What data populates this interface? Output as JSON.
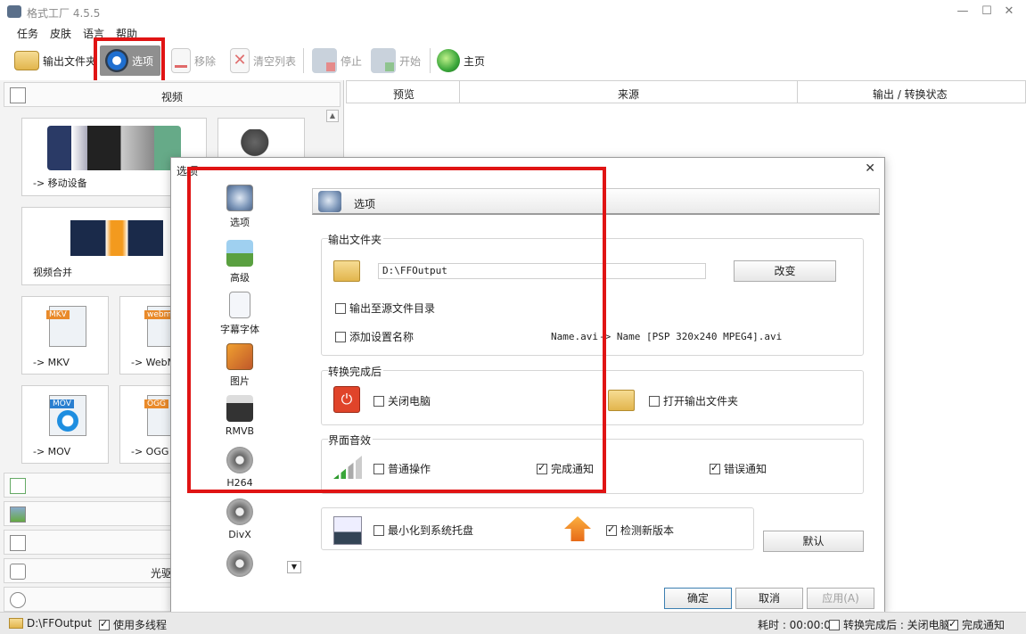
{
  "window": {
    "title": "格式工厂 4.5.5"
  },
  "menu": [
    "任务",
    "皮肤",
    "语言",
    "帮助"
  ],
  "toolbar": {
    "output_folder": "输出文件夹",
    "options": "选项",
    "remove": "移除",
    "clear_list": "清空列表",
    "stop": "停止",
    "start": "开始",
    "home": "主页"
  },
  "left": {
    "video_header": "视频",
    "tiles": {
      "mobile": "-> 移动设备",
      "merge": "视频合并",
      "mkv": "-> MKV",
      "webm": "-> WebM",
      "mov": "-> MOV",
      "ogg": "-> OGG"
    },
    "tile_badges": {
      "mkv": "MKV",
      "webm": "webm",
      "mov": "MOV",
      "ogg": "OGG"
    },
    "optical_header": "光驱设备"
  },
  "list_header": {
    "preview": "预览",
    "source": "来源",
    "status": "输出 / 转换状态"
  },
  "status": {
    "output_path": "D:\\FFOutput",
    "multithread": "使用多线程",
    "elapsed": "耗时 : 00:00:00",
    "after_convert": "转换完成后 : 关闭电脑",
    "notify": "完成通知"
  },
  "dialog": {
    "title": "选项",
    "nav": [
      "选项",
      "高级",
      "字幕字体",
      "图片",
      "RMVB",
      "H264",
      "DivX"
    ],
    "section_title": "选项",
    "output_folder_group": "输出文件夹",
    "output_path": "D:\\FFOutput",
    "change": "改变",
    "to_source_dir": "输出至源文件目录",
    "add_setting_name": "添加设置名称",
    "name_example_src": "Name.avi",
    "name_example_dst": "-> Name [PSP 320x240 MPEG4].avi",
    "after_group": "转换完成后",
    "shutdown": "关闭电脑",
    "open_output": "打开输出文件夹",
    "sound_group": "界面音效",
    "normal_op": "普通操作",
    "done_notify": "完成通知",
    "error_notify": "错误通知",
    "minimize_tray": "最小化到系统托盘",
    "check_update": "检测新版本",
    "default": "默认",
    "ok": "确定",
    "cancel": "取消",
    "apply": "应用(A)"
  },
  "colors": {
    "highlight": "#e01414"
  }
}
